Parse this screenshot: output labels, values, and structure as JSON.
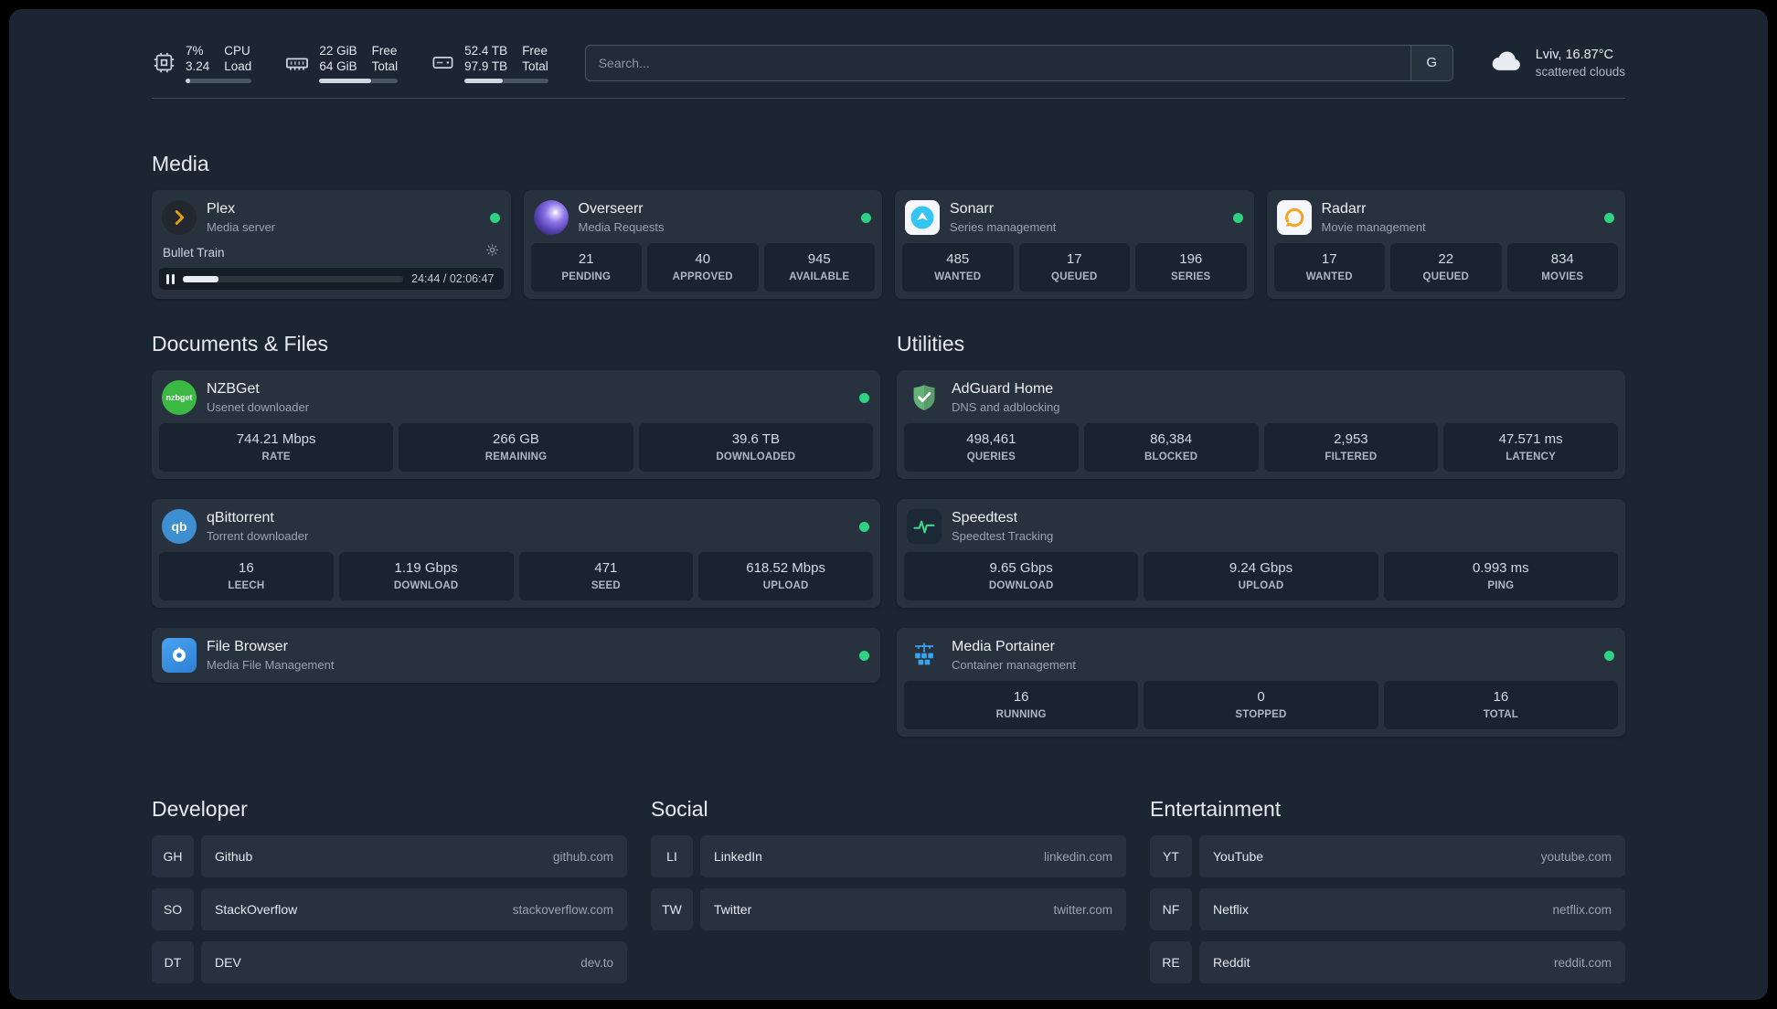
{
  "theme": {
    "background": "#1c2633",
    "card": "#28323f",
    "tile": "#1a2330",
    "text_primary": "#e6eaf0",
    "text_secondary": "#98a2b0",
    "status_online": "#2fd283",
    "plex_amber": "#e5a00d",
    "sonarr_blue": "#35c5f4",
    "radarr_amber": "#f5a623",
    "nzbget_green": "#3cb943",
    "qbittorrent_blue": "#3d8fd1",
    "adguard_green": "#67b279",
    "speedtest_green": "#3dd68c",
    "portainer_blue": "#37a5ee"
  },
  "topbar": {
    "cpu": {
      "icon": "cpu-icon",
      "percent": "7%",
      "load": "3.24",
      "label_top": "CPU",
      "label_bottom": "Load",
      "bar": "7%"
    },
    "memory": {
      "icon": "memory-icon",
      "free": "22 GiB",
      "total": "64 GiB",
      "label_top": "Free",
      "label_bottom": "Total",
      "bar": "66%"
    },
    "disk": {
      "icon": "disk-icon",
      "free": "52.4 TB",
      "total": "97.9 TB",
      "label_top": "Free",
      "label_bottom": "Total",
      "bar": "46%"
    },
    "search": {
      "placeholder": "Search...",
      "provider": "G"
    },
    "weather": {
      "icon": "cloud-icon",
      "location": "Lviv, 16.87°C",
      "condition": "scattered clouds"
    }
  },
  "media": {
    "title": "Media",
    "cards": [
      {
        "title": "Plex",
        "subtitle": "Media server",
        "status": "online",
        "player": {
          "track": "Bullet Train",
          "time": "24:44 / 02:06:47",
          "progress": "16%"
        }
      },
      {
        "title": "Overseerr",
        "subtitle": "Media Requests",
        "status": "online",
        "stats": [
          {
            "value": "21",
            "label": "PENDING"
          },
          {
            "value": "40",
            "label": "APPROVED"
          },
          {
            "value": "945",
            "label": "AVAILABLE"
          }
        ]
      },
      {
        "title": "Sonarr",
        "subtitle": "Series management",
        "status": "online",
        "stats": [
          {
            "value": "485",
            "label": "WANTED"
          },
          {
            "value": "17",
            "label": "QUEUED"
          },
          {
            "value": "196",
            "label": "SERIES"
          }
        ]
      },
      {
        "title": "Radarr",
        "subtitle": "Movie management",
        "status": "online",
        "stats": [
          {
            "value": "17",
            "label": "WANTED"
          },
          {
            "value": "22",
            "label": "QUEUED"
          },
          {
            "value": "834",
            "label": "MOVIES"
          }
        ]
      }
    ]
  },
  "documents": {
    "title": "Documents & Files",
    "cards": [
      {
        "title": "NZBGet",
        "subtitle": "Usenet downloader",
        "status": "online",
        "stats": [
          {
            "value": "744.21 Mbps",
            "label": "RATE"
          },
          {
            "value": "266 GB",
            "label": "REMAINING"
          },
          {
            "value": "39.6 TB",
            "label": "DOWNLOADED"
          }
        ]
      },
      {
        "title": "qBittorrent",
        "subtitle": "Torrent downloader",
        "status": "online",
        "stats": [
          {
            "value": "16",
            "label": "LEECH"
          },
          {
            "value": "1.19 Gbps",
            "label": "DOWNLOAD"
          },
          {
            "value": "471",
            "label": "SEED"
          },
          {
            "value": "618.52 Mbps",
            "label": "UPLOAD"
          }
        ]
      },
      {
        "title": "File Browser",
        "subtitle": "Media File Management",
        "status": "online"
      }
    ]
  },
  "utilities": {
    "title": "Utilities",
    "cards": [
      {
        "title": "AdGuard Home",
        "subtitle": "DNS and adblocking",
        "stats": [
          {
            "value": "498,461",
            "label": "QUERIES"
          },
          {
            "value": "86,384",
            "label": "BLOCKED"
          },
          {
            "value": "2,953",
            "label": "FILTERED"
          },
          {
            "value": "47.571 ms",
            "label": "LATENCY"
          }
        ]
      },
      {
        "title": "Speedtest",
        "subtitle": "Speedtest Tracking",
        "stats": [
          {
            "value": "9.65 Gbps",
            "label": "DOWNLOAD"
          },
          {
            "value": "9.24 Gbps",
            "label": "UPLOAD"
          },
          {
            "value": "0.993 ms",
            "label": "PING"
          }
        ]
      },
      {
        "title": "Media Portainer",
        "subtitle": "Container management",
        "status": "online",
        "stats": [
          {
            "value": "16",
            "label": "RUNNING"
          },
          {
            "value": "0",
            "label": "STOPPED"
          },
          {
            "value": "16",
            "label": "TOTAL"
          }
        ]
      }
    ]
  },
  "bookmarks": [
    {
      "title": "Developer",
      "items": [
        {
          "abbr": "GH",
          "name": "Github",
          "url": "github.com"
        },
        {
          "abbr": "SO",
          "name": "StackOverflow",
          "url": "stackoverflow.com"
        },
        {
          "abbr": "DT",
          "name": "DEV",
          "url": "dev.to"
        }
      ]
    },
    {
      "title": "Social",
      "items": [
        {
          "abbr": "LI",
          "name": "LinkedIn",
          "url": "linkedin.com"
        },
        {
          "abbr": "TW",
          "name": "Twitter",
          "url": "twitter.com"
        }
      ]
    },
    {
      "title": "Entertainment",
      "items": [
        {
          "abbr": "YT",
          "name": "YouTube",
          "url": "youtube.com"
        },
        {
          "abbr": "NF",
          "name": "Netflix",
          "url": "netflix.com"
        },
        {
          "abbr": "RE",
          "name": "Reddit",
          "url": "reddit.com"
        }
      ]
    }
  ]
}
